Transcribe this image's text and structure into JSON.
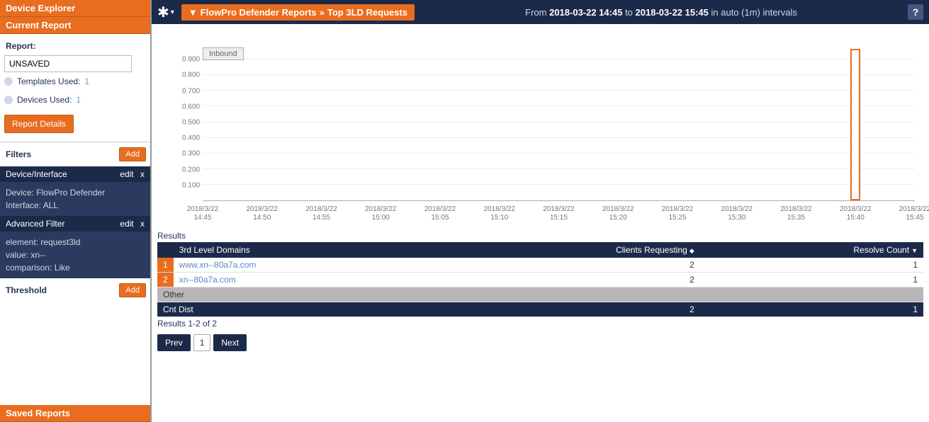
{
  "sidebar": {
    "device_explorer": "Device Explorer",
    "current_report": "Current Report",
    "report_label": "Report:",
    "report_value": "UNSAVED",
    "templates_label": "Templates Used:",
    "templates_count": "1",
    "devices_label": "Devices Used:",
    "devices_count": "1",
    "report_details_btn": "Report Details",
    "filters_label": "Filters",
    "add_btn": "Add",
    "filter1": {
      "title": "Device/Interface",
      "edit": "edit",
      "close": "x",
      "device": "Device: FlowPro Defender",
      "interface": "Interface: ALL"
    },
    "filter2": {
      "title": "Advanced Filter",
      "edit": "edit",
      "close": "x",
      "element": "element: request3ld",
      "value": "value: xn--",
      "comparison": "comparison: Like"
    },
    "threshold_label": "Threshold",
    "saved_reports": "Saved Reports"
  },
  "topbar": {
    "breadcrumb1": "FlowPro Defender Reports",
    "sep": "»",
    "breadcrumb2": "Top 3LD Requests",
    "from_label": "From ",
    "from": "2018-03-22 14:45",
    "to_label": " to ",
    "to": "2018-03-22 15:45",
    "interval_label": " in auto (1m) intervals",
    "help": "?"
  },
  "chart_data": {
    "type": "bar",
    "series_name": "Inbound",
    "y_ticks": [
      "0.100",
      "0.200",
      "0.300",
      "0.400",
      "0.500",
      "0.600",
      "0.700",
      "0.800",
      "0.900"
    ],
    "x_ticks": [
      {
        "l1": "2018/3/22",
        "l2": "14:45"
      },
      {
        "l1": "2018/3/22",
        "l2": "14:50"
      },
      {
        "l1": "2018/3/22",
        "l2": "14:55"
      },
      {
        "l1": "2018/3/22",
        "l2": "15:00"
      },
      {
        "l1": "2018/3/22",
        "l2": "15:05"
      },
      {
        "l1": "2018/3/22",
        "l2": "15:10"
      },
      {
        "l1": "2018/3/22",
        "l2": "15:15"
      },
      {
        "l1": "2018/3/22",
        "l2": "15:20"
      },
      {
        "l1": "2018/3/22",
        "l2": "15:25"
      },
      {
        "l1": "2018/3/22",
        "l2": "15:30"
      },
      {
        "l1": "2018/3/22",
        "l2": "15:35"
      },
      {
        "l1": "2018/3/22",
        "l2": "15:40"
      },
      {
        "l1": "2018/3/22",
        "l2": "15:45"
      }
    ],
    "bars": [
      {
        "x_index": 11,
        "value": 0.97
      }
    ],
    "ylim": [
      0,
      1.0
    ]
  },
  "results": {
    "label": "Results",
    "headers": {
      "domain": "3rd Level Domains",
      "clients": "Clients Requesting",
      "resolve": "Resolve Count"
    },
    "rows": [
      {
        "n": "1",
        "domain": "www.xn--80a7a.com",
        "clients": "2",
        "resolve": "1"
      },
      {
        "n": "2",
        "domain": "xn--80a7a.com",
        "clients": "2",
        "resolve": "1"
      }
    ],
    "other_label": "Other",
    "cntdist_label": "Cnt Dist",
    "cntdist_clients": "2",
    "cntdist_resolve": "1",
    "count_text": "Results 1-2 of 2",
    "prev": "Prev",
    "page1": "1",
    "next": "Next"
  }
}
